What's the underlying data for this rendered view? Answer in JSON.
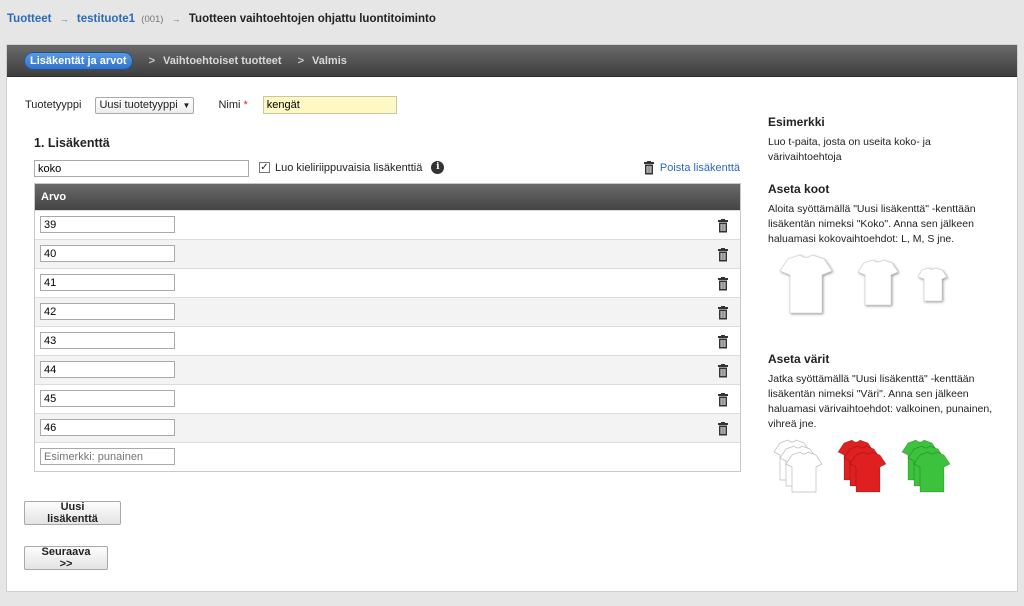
{
  "breadcrumb": {
    "items": [
      "Tuotteet",
      "testituote1"
    ],
    "code": "(001)",
    "current": "Tuotteen vaihtoehtojen ohjattu luontitoiminto",
    "separator": "→"
  },
  "wizard": {
    "steps": [
      "Lisäkentät ja arvot",
      "Vaihtoehtoiset tuotteet",
      "Valmis"
    ],
    "separator": ">"
  },
  "form": {
    "type_label": "Tuotetyyppi",
    "type_value": "Uusi tuotetyyppi",
    "name_label": "Nimi",
    "required_mark": "*",
    "name_value": "kengät"
  },
  "field": {
    "title": "1. Lisäkenttä",
    "name_value": "koko",
    "checkbox_label": "Luo kieliriippuvaisia lisäkenttiä",
    "checkbox_checked": true,
    "checkbox_mark": "✓",
    "info_mark": "i",
    "delete_label": "Poista lisäkenttä",
    "column_header": "Arvo",
    "values": [
      "39",
      "40",
      "41",
      "42",
      "43",
      "44",
      "45",
      "46"
    ],
    "new_value_placeholder": "Esimerkki: punainen"
  },
  "buttons": {
    "new_field": "Uusi lisäkenttä",
    "next": "Seuraava >>"
  },
  "sidebar": {
    "example_title": "Esimerkki",
    "example_text": "Luo t-paita, josta on useita koko- ja värivaihtoehtoja",
    "sizes_title": "Aseta koot",
    "sizes_text": "Aloita syöttämällä \"Uusi lisäkenttä\" -kenttään lisäkentän nimeksi \"Koko\". Anna sen jälkeen haluamasi kokovaihtoehdot: L, M, S jne.",
    "colors_title": "Aseta värit",
    "colors_text": "Jatka syöttämällä \"Uusi lisäkenttä\" -kenttään lisäkentän nimeksi \"Väri\". Anna sen jälkeen haluamasi värivaihtoehdot: valkoinen, punainen, vihreä jne.",
    "shirt_colors": [
      "#ffffff",
      "#e02020",
      "#3cc23c"
    ]
  },
  "colors": {
    "accent": "#2f6fc9",
    "link": "#2a6bb8",
    "name_field_bg": "#fdf8c4"
  }
}
